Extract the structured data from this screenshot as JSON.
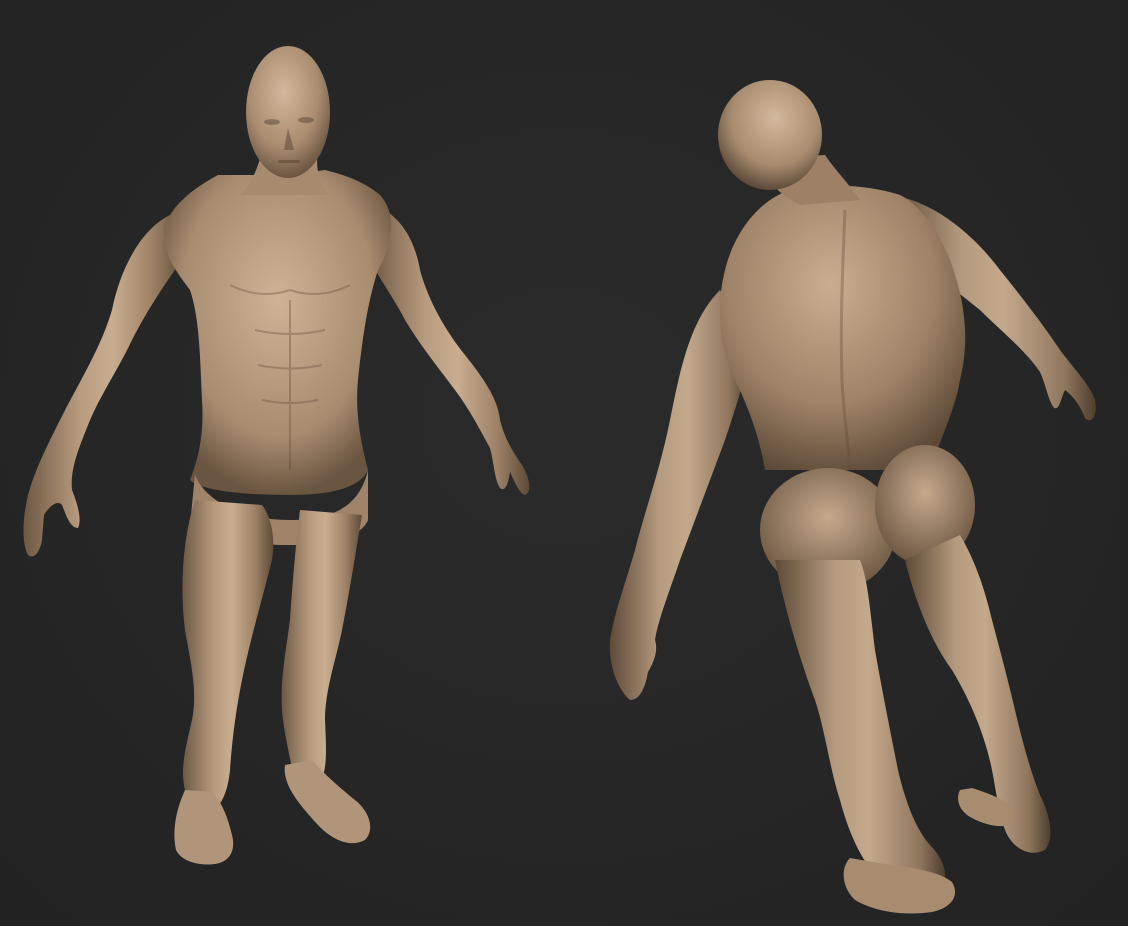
{
  "scene": {
    "background_color": "#252525",
    "material_color": "#a58b70",
    "highlight_color": "#cdb397",
    "shadow_color": "#5f4c3a",
    "views": [
      {
        "name": "front-view",
        "description_icon": "figure-front-icon"
      },
      {
        "name": "back-view",
        "description_icon": "figure-back-icon"
      }
    ]
  }
}
